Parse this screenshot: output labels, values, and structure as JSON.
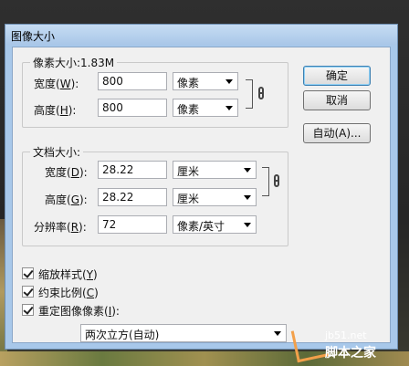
{
  "window": {
    "title": "图像大小"
  },
  "pixel_dimensions": {
    "title": "像素大小:1.83M",
    "width": {
      "label": "宽度(",
      "key": "W",
      "suffix": "):",
      "value": "800",
      "unit": "像素"
    },
    "height": {
      "label": "高度(",
      "key": "H",
      "suffix": "):",
      "value": "800",
      "unit": "像素"
    }
  },
  "document_size": {
    "title": "文档大小:",
    "width": {
      "label": "宽度(",
      "key": "D",
      "suffix": "):",
      "value": "28.22",
      "unit": "厘米"
    },
    "height": {
      "label": "高度(",
      "key": "G",
      "suffix": "):",
      "value": "28.22",
      "unit": "厘米"
    },
    "resolution": {
      "label": "分辨率(",
      "key": "R",
      "suffix": "):",
      "value": "72",
      "unit": "像素/英寸"
    }
  },
  "buttons": {
    "ok": "确定",
    "cancel": "取消",
    "auto": "自动(A)..."
  },
  "options": {
    "scale_styles": {
      "label": "缩放样式(",
      "key": "Y",
      "suffix": ")",
      "checked": true
    },
    "constrain": {
      "label": "约束比例(",
      "key": "C",
      "suffix": ")",
      "checked": true
    },
    "resample": {
      "label": "重定图像像素(",
      "key": "I",
      "suffix": "):",
      "checked": true
    },
    "resample_method": "两次立方(自动)"
  },
  "watermark": {
    "line1": "jb51.net",
    "line2": "脚本之家"
  },
  "icons": [
    "chain-link-icon",
    "dropdown-arrow-icon",
    "checkbox-checked-icon"
  ]
}
